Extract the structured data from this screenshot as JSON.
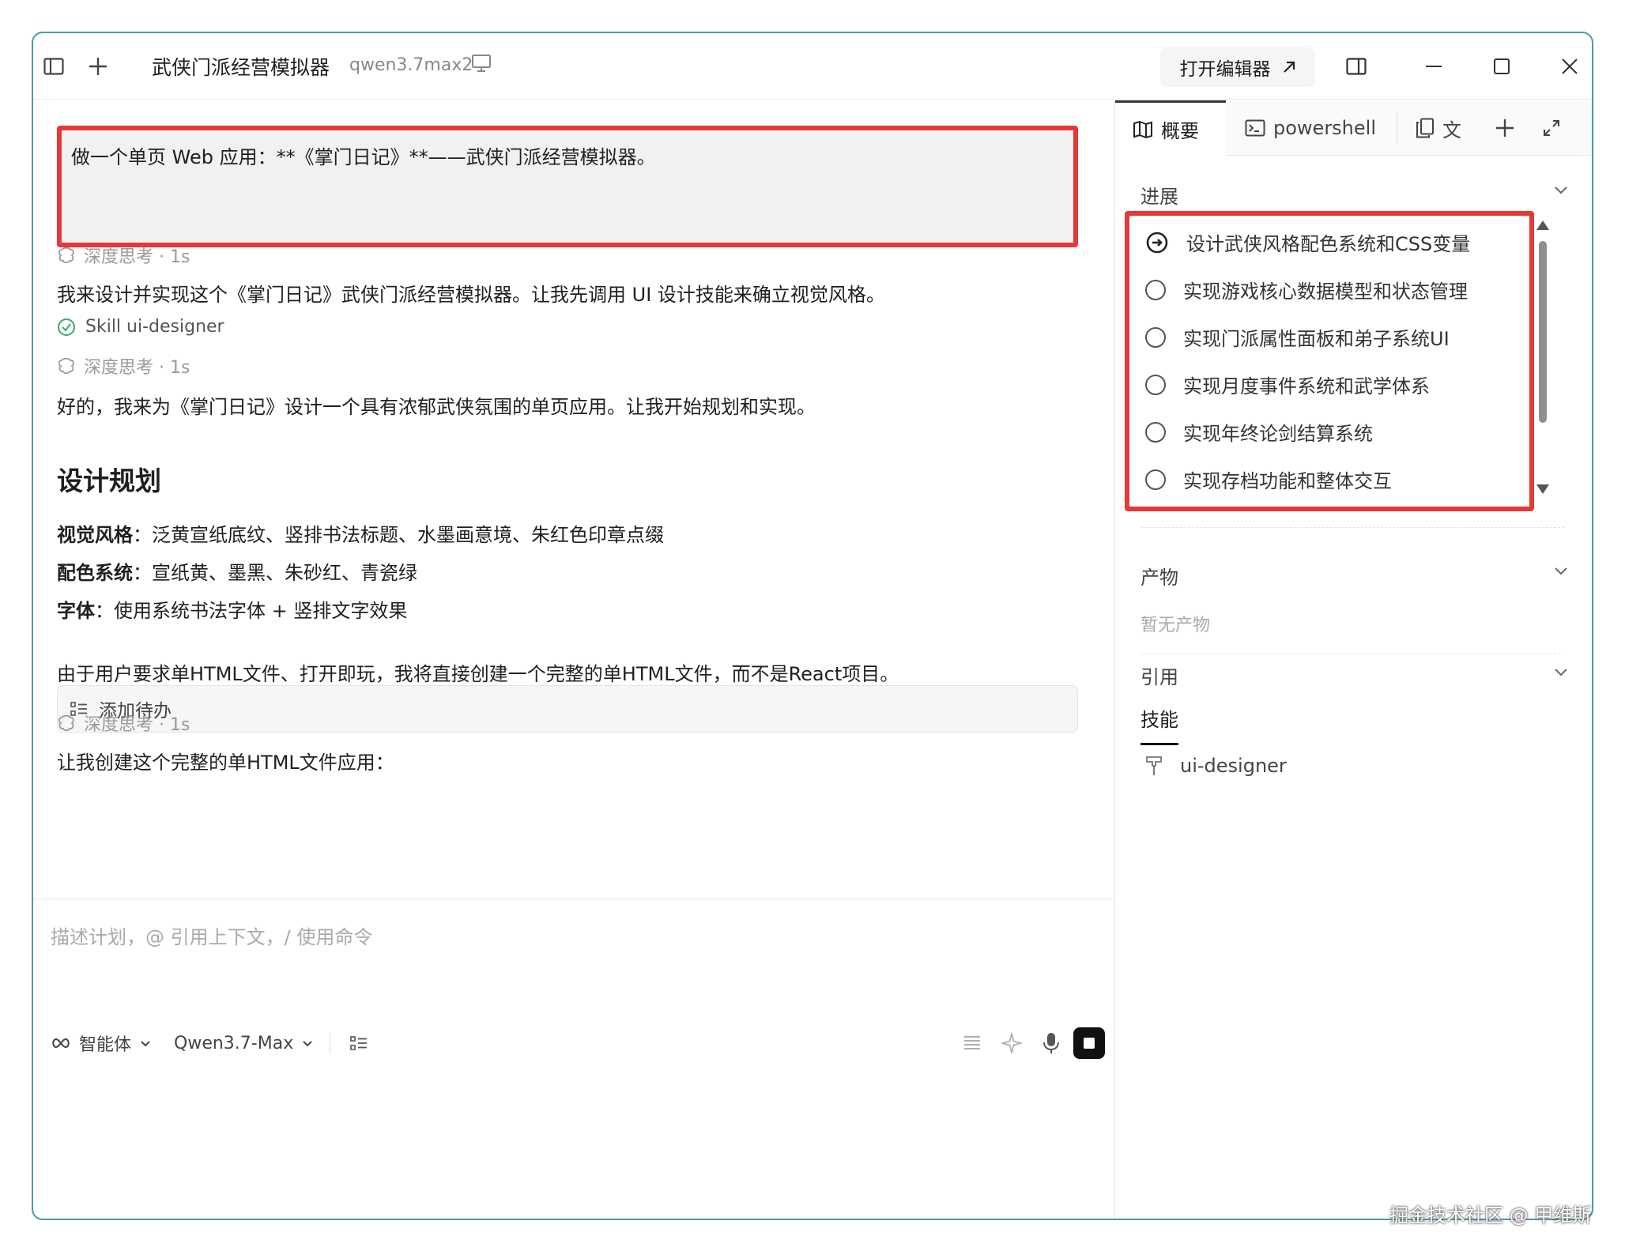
{
  "titlebar": {
    "title": "武侠门派经营模拟器",
    "subtitle": "qwen3.7max2",
    "open_editor_label": "打开编辑器"
  },
  "chat": {
    "prompt": "做一个单页 Web 应用：**《掌门日记》**——武侠门派经营模拟器。",
    "think_label_1": "深度思考 · 1s",
    "para_1": "我来设计并实现这个《掌门日记》武侠门派经营模拟器。让我先调用 UI 设计技能来确立视觉风格。",
    "skill_label": "Skill ui-designer",
    "think_label_2": "深度思考 · 1s",
    "para_2": "好的，我来为《掌门日记》设计一个具有浓郁武侠氛围的单页应用。让我开始规划和实现。",
    "heading": "设计规划",
    "plan": [
      {
        "key": "视觉风格",
        "value": "：泛黄宣纸底纹、竖排书法标题、水墨画意境、朱红色印章点缀"
      },
      {
        "key": "配色系统",
        "value": "：宣纸黄、墨黑、朱砂红、青瓷绿"
      },
      {
        "key": "字体",
        "value": "：使用系统书法字体 + 竖排文字效果"
      }
    ],
    "para_3": "由于用户要求单HTML文件、打开即玩，我将直接创建一个完整的单HTML文件，而不是React项目。",
    "todo_label": "添加待办",
    "think_label_3": "深度思考 · 1s",
    "para_4": "让我创建这个完整的单HTML文件应用："
  },
  "composer": {
    "placeholder": "描述计划，@ 引用上下文，/ 使用命令",
    "agent_label": "智能体",
    "model_label": "Qwen3.7-Max"
  },
  "panel": {
    "tabs": [
      {
        "label": "概要",
        "icon": "map-icon"
      },
      {
        "label": "powershell",
        "icon": "terminal-icon"
      },
      {
        "label": "文",
        "icon": "copy-icon"
      }
    ],
    "progress_title": "进展",
    "tasks": [
      {
        "label": "设计武侠风格配色系统和CSS变量",
        "status": "in-progress"
      },
      {
        "label": "实现游戏核心数据模型和状态管理",
        "status": "pending"
      },
      {
        "label": "实现门派属性面板和弟子系统UI",
        "status": "pending"
      },
      {
        "label": "实现月度事件系统和武学体系",
        "status": "pending"
      },
      {
        "label": "实现年终论剑结算系统",
        "status": "pending"
      },
      {
        "label": "实现存档功能和整体交互",
        "status": "pending"
      }
    ],
    "artifacts_title": "产物",
    "artifacts_empty": "暂无产物",
    "references_title": "引用",
    "skills_tab": "技能",
    "skill_item": "ui-designer"
  },
  "watermark": "掘金技术社区 @ 甲维斯",
  "colors": {
    "highlight_red": "#e53935",
    "window_border": "#4a9aa8",
    "success_green": "#3aa86b"
  }
}
